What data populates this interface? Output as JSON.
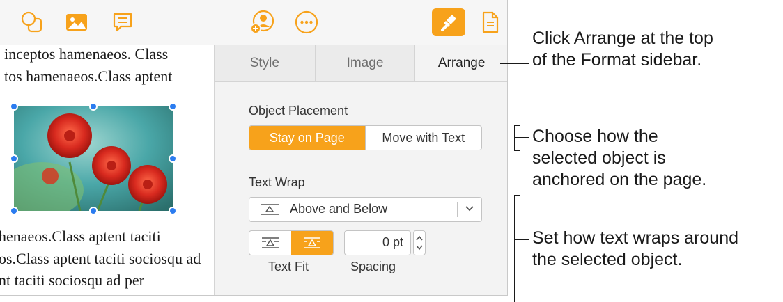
{
  "toolbar": {
    "left_icons": [
      "shape-icon",
      "media-icon",
      "comment-icon"
    ],
    "center_icons": [
      "collaborate-icon",
      "more-icon"
    ],
    "right_icons": [
      "format-icon",
      "document-icon"
    ],
    "accent": "#f7a21b"
  },
  "document": {
    "lines_above": [
      "inceptos hamenaeos. Class",
      "tos hamenaeos.Class aptent"
    ],
    "lines_below": [
      "henaeos.Class aptent taciti",
      "os.Class aptent taciti sociosqu ad",
      "nt taciti sociosqu ad per"
    ]
  },
  "sidebar": {
    "tabs": [
      {
        "label": "Style"
      },
      {
        "label": "Image"
      },
      {
        "label": "Arrange"
      }
    ],
    "object_placement": {
      "title": "Object Placement",
      "options": [
        "Stay on Page",
        "Move with Text"
      ],
      "selected": "Stay on Page"
    },
    "text_wrap": {
      "title": "Text Wrap",
      "selected": "Above and Below",
      "text_fit_label": "Text Fit",
      "spacing_value": "0 pt",
      "spacing_label": "Spacing"
    }
  },
  "callouts": {
    "arrange": "Click Arrange at the top\nof the Format sidebar.",
    "placement": "Choose how the\nselected object is\nanchored on the page.",
    "wrap": "Set how text wraps around\nthe selected object."
  }
}
